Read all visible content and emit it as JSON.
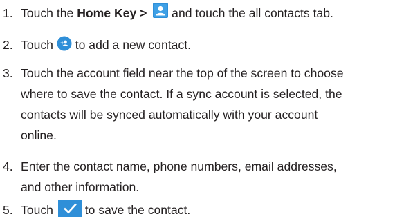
{
  "steps": [
    {
      "number": "1.",
      "text_a": "Touch the ",
      "bold": "Home Key >",
      "icon": "contacts-app-icon",
      "text_b": " and touch the all contacts tab."
    },
    {
      "number": "2.",
      "text_a": "Touch ",
      "icon": "add-contact-fab-icon",
      "text_b": " to add a new contact."
    },
    {
      "number": "3.",
      "lines": [
        "Touch the account field near the top of the screen to choose",
        "where to save the contact. If a sync account is selected, the",
        "contacts will be synced automatically with your account",
        "online."
      ]
    },
    {
      "number": "4.",
      "lines": [
        "Enter the contact name, phone numbers, email addresses,",
        "and other information."
      ]
    },
    {
      "number": "5.",
      "text_a": "Touch ",
      "icon": "checkmark-save-icon",
      "text_b": " to save the contact."
    }
  ],
  "colors": {
    "text": "#231f20",
    "icon_blue": "#2f8fd8",
    "icon_dark": "#1c4f7a"
  }
}
